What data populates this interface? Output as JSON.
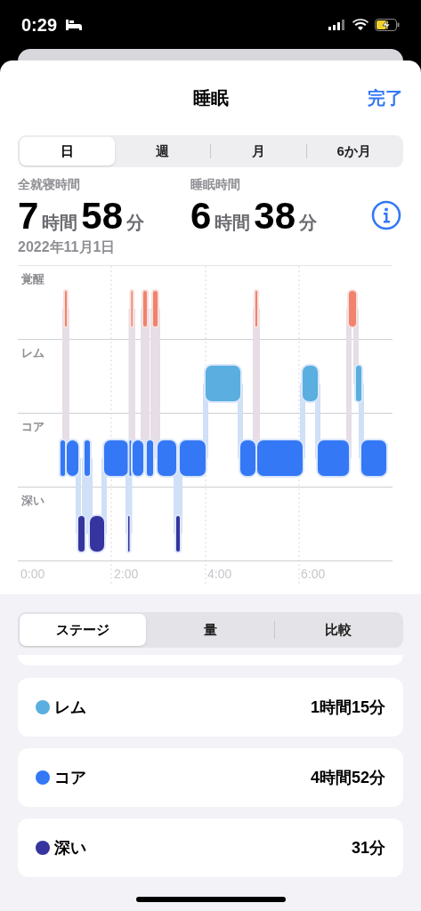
{
  "status_bar": {
    "time": "0:29"
  },
  "header": {
    "title": "睡眠",
    "done_button": "完了"
  },
  "period_tabs": [
    {
      "label": "日",
      "selected": true
    },
    {
      "label": "週",
      "selected": false
    },
    {
      "label": "月",
      "selected": false
    },
    {
      "label": "6か月",
      "selected": false
    }
  ],
  "summary": [
    {
      "label": "全就寝時間",
      "hours": "7",
      "hours_unit": "時間",
      "minutes": "58",
      "minutes_unit": "分"
    },
    {
      "label": "睡眠時間",
      "hours": "6",
      "hours_unit": "時間",
      "minutes": "38",
      "minutes_unit": "分"
    }
  ],
  "date": "2022年11月1日",
  "chart": {
    "stage_labels": [
      "覚醒",
      "レム",
      "コア",
      "深い"
    ],
    "time_labels": [
      "0:00",
      "2:00",
      "4:00",
      "6:00"
    ]
  },
  "view_tabs": [
    {
      "label": "ステージ",
      "selected": true
    },
    {
      "label": "量",
      "selected": false
    },
    {
      "label": "比較",
      "selected": false
    }
  ],
  "stages": [
    {
      "name": "レム",
      "duration": "1時間15分",
      "color": "#5aaee0"
    },
    {
      "name": "コア",
      "duration": "4時間52分",
      "color": "#3478f6"
    },
    {
      "name": "深い",
      "duration": "31分",
      "color": "#36349e"
    }
  ]
}
